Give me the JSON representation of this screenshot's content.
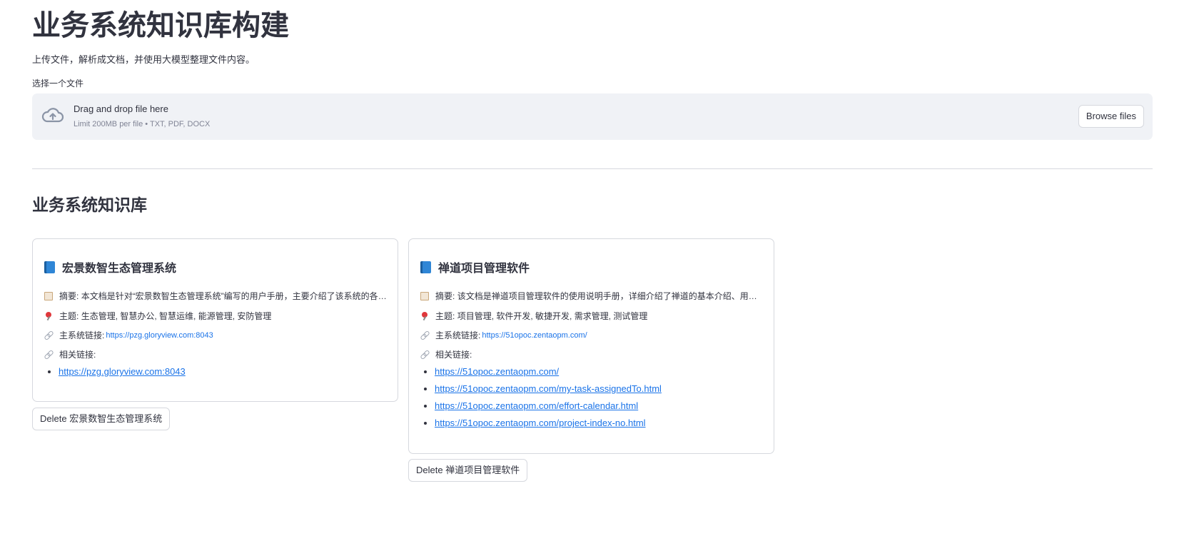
{
  "app": {
    "title": "业务系统知识库构建",
    "subtitle": "上传文件，解析成文档，并使用大模型整理文件内容。"
  },
  "uploader": {
    "label": "选择一个文件",
    "drag_text": "Drag and drop file here",
    "limit_text": "Limit 200MB per file • TXT, PDF, DOCX",
    "browse_label": "Browse files",
    "icon": "cloud-upload-icon"
  },
  "knowledge_base": {
    "heading": "业务系统知识库",
    "cards": [
      {
        "title": "宏景数智生态管理系统",
        "summary_label": "摘要:",
        "summary": "本文档是针对“宏景数智生态管理系统”编写的用户手册，主要介绍了该系统的各项…",
        "topic_label": "主题:",
        "topics": "生态管理, 智慧办公, 智慧运维, 能源管理, 安防管理",
        "main_link_label": "主系统链接:",
        "main_link": "https://pzg.gloryview.com:8043",
        "related_label": "相关链接:",
        "related_links": [
          "https://pzg.gloryview.com:8043"
        ],
        "delete_label": "Delete 宏景数智生态管理系统"
      },
      {
        "title": "禅道项目管理软件",
        "summary_label": "摘要:",
        "summary": "该文档是禅道项目管理软件的使用说明手册，详细介绍了禅道的基本介绍、用户角…",
        "topic_label": "主题:",
        "topics": "项目管理, 软件开发, 敏捷开发, 需求管理, 测试管理",
        "main_link_label": "主系统链接:",
        "main_link": "https://51opoc.zentaopm.com/",
        "related_label": "相关链接:",
        "related_links": [
          "https://51opoc.zentaopm.com/",
          "https://51opoc.zentaopm.com/my-task-assignedTo.html",
          "https://51opoc.zentaopm.com/effort-calendar.html",
          "https://51opoc.zentaopm.com/project-index-no.html"
        ],
        "delete_label": "Delete 禅道项目管理软件"
      }
    ]
  },
  "icons": {
    "card_title": "book-icon",
    "summary": "memo-icon",
    "topic": "pushpin-icon",
    "link": "link-icon"
  },
  "colors": {
    "text": "#31333f",
    "link": "#1a73e8",
    "dropzone_bg": "#f0f2f6",
    "border": "#d6d8de"
  }
}
